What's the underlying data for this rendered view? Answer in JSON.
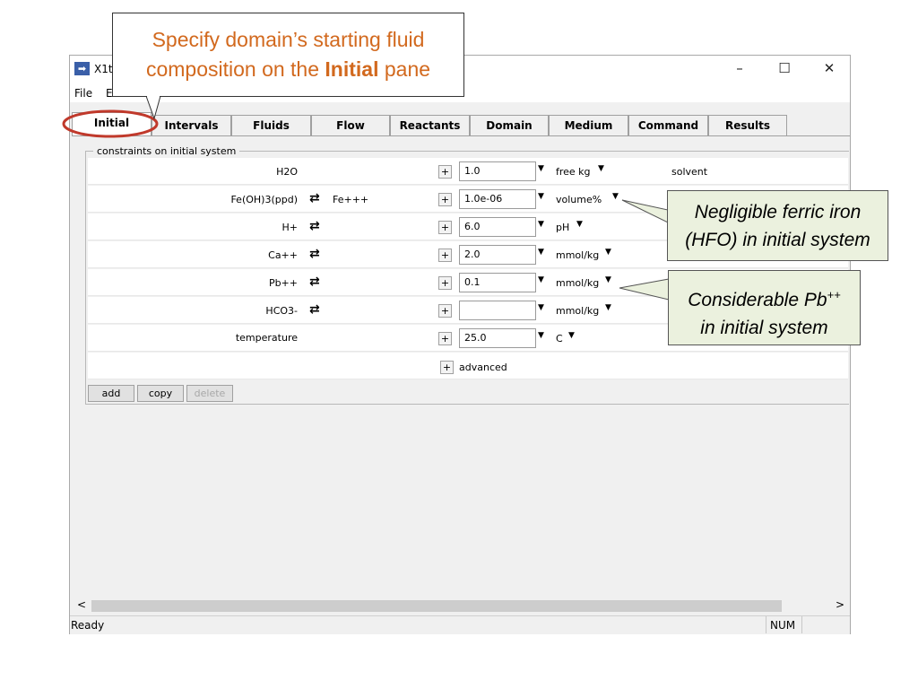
{
  "window": {
    "title": "X1t",
    "controls": {
      "minimize": "–",
      "maximize": "☐",
      "close": "✕"
    }
  },
  "menu": {
    "items": [
      "File",
      "E"
    ]
  },
  "tabs": [
    "Initial",
    "Intervals",
    "Fluids",
    "Flow",
    "Reactants",
    "Domain",
    "Medium",
    "Command",
    "Results"
  ],
  "group": {
    "legend": "constraints on initial system",
    "rows": [
      {
        "species": "H2O",
        "swap": false,
        "swap_species": "",
        "value": "1.0",
        "unit": "free kg",
        "note": "solvent"
      },
      {
        "species": "Fe(OH)3(ppd)",
        "swap": true,
        "swap_species": "Fe+++",
        "value": "1.0e-06",
        "unit": "volume%",
        "note": ""
      },
      {
        "species": "H+",
        "swap": true,
        "swap_species": "",
        "value": "6.0",
        "unit": "pH",
        "note": ""
      },
      {
        "species": "Ca++",
        "swap": true,
        "swap_species": "",
        "value": "2.0",
        "unit": "mmol/kg",
        "note": ""
      },
      {
        "species": "Pb++",
        "swap": true,
        "swap_species": "",
        "value": "0.1",
        "unit": "mmol/kg",
        "note": ""
      },
      {
        "species": "HCO3-",
        "swap": true,
        "swap_species": "",
        "value": "",
        "unit": "mmol/kg",
        "note": ""
      },
      {
        "species": "temperature",
        "swap": false,
        "swap_species": "",
        "value": "25.0",
        "unit": "C",
        "note": ""
      }
    ],
    "advanced_label": "advanced",
    "buttons": {
      "add": "add",
      "copy": "copy",
      "delete": "delete"
    }
  },
  "status": {
    "left": "Ready",
    "num": "NUM"
  },
  "icons": {
    "plus": "+",
    "swap": "⇄",
    "dropdown": "▼",
    "scroll_left": "<",
    "scroll_right": ">",
    "app": "➡"
  },
  "annotations": {
    "top_line1": "Specify domain’s starting fluid",
    "top_line2_pre": "composition on the ",
    "top_line2_bold": "Initial",
    "top_line2_post": " pane",
    "ferric_line1": "Negligible ferric iron",
    "ferric_line2": "(HFO) in initial system",
    "pb_line1_pre": "Considerable Pb",
    "pb_sup": "++",
    "pb_line2": "in initial system"
  },
  "colors": {
    "callout_text": "#d2691e",
    "callout_green_bg": "#ebf1de",
    "highlight_ellipse": "#c0392b",
    "app_icon": "#3a5fa8"
  }
}
